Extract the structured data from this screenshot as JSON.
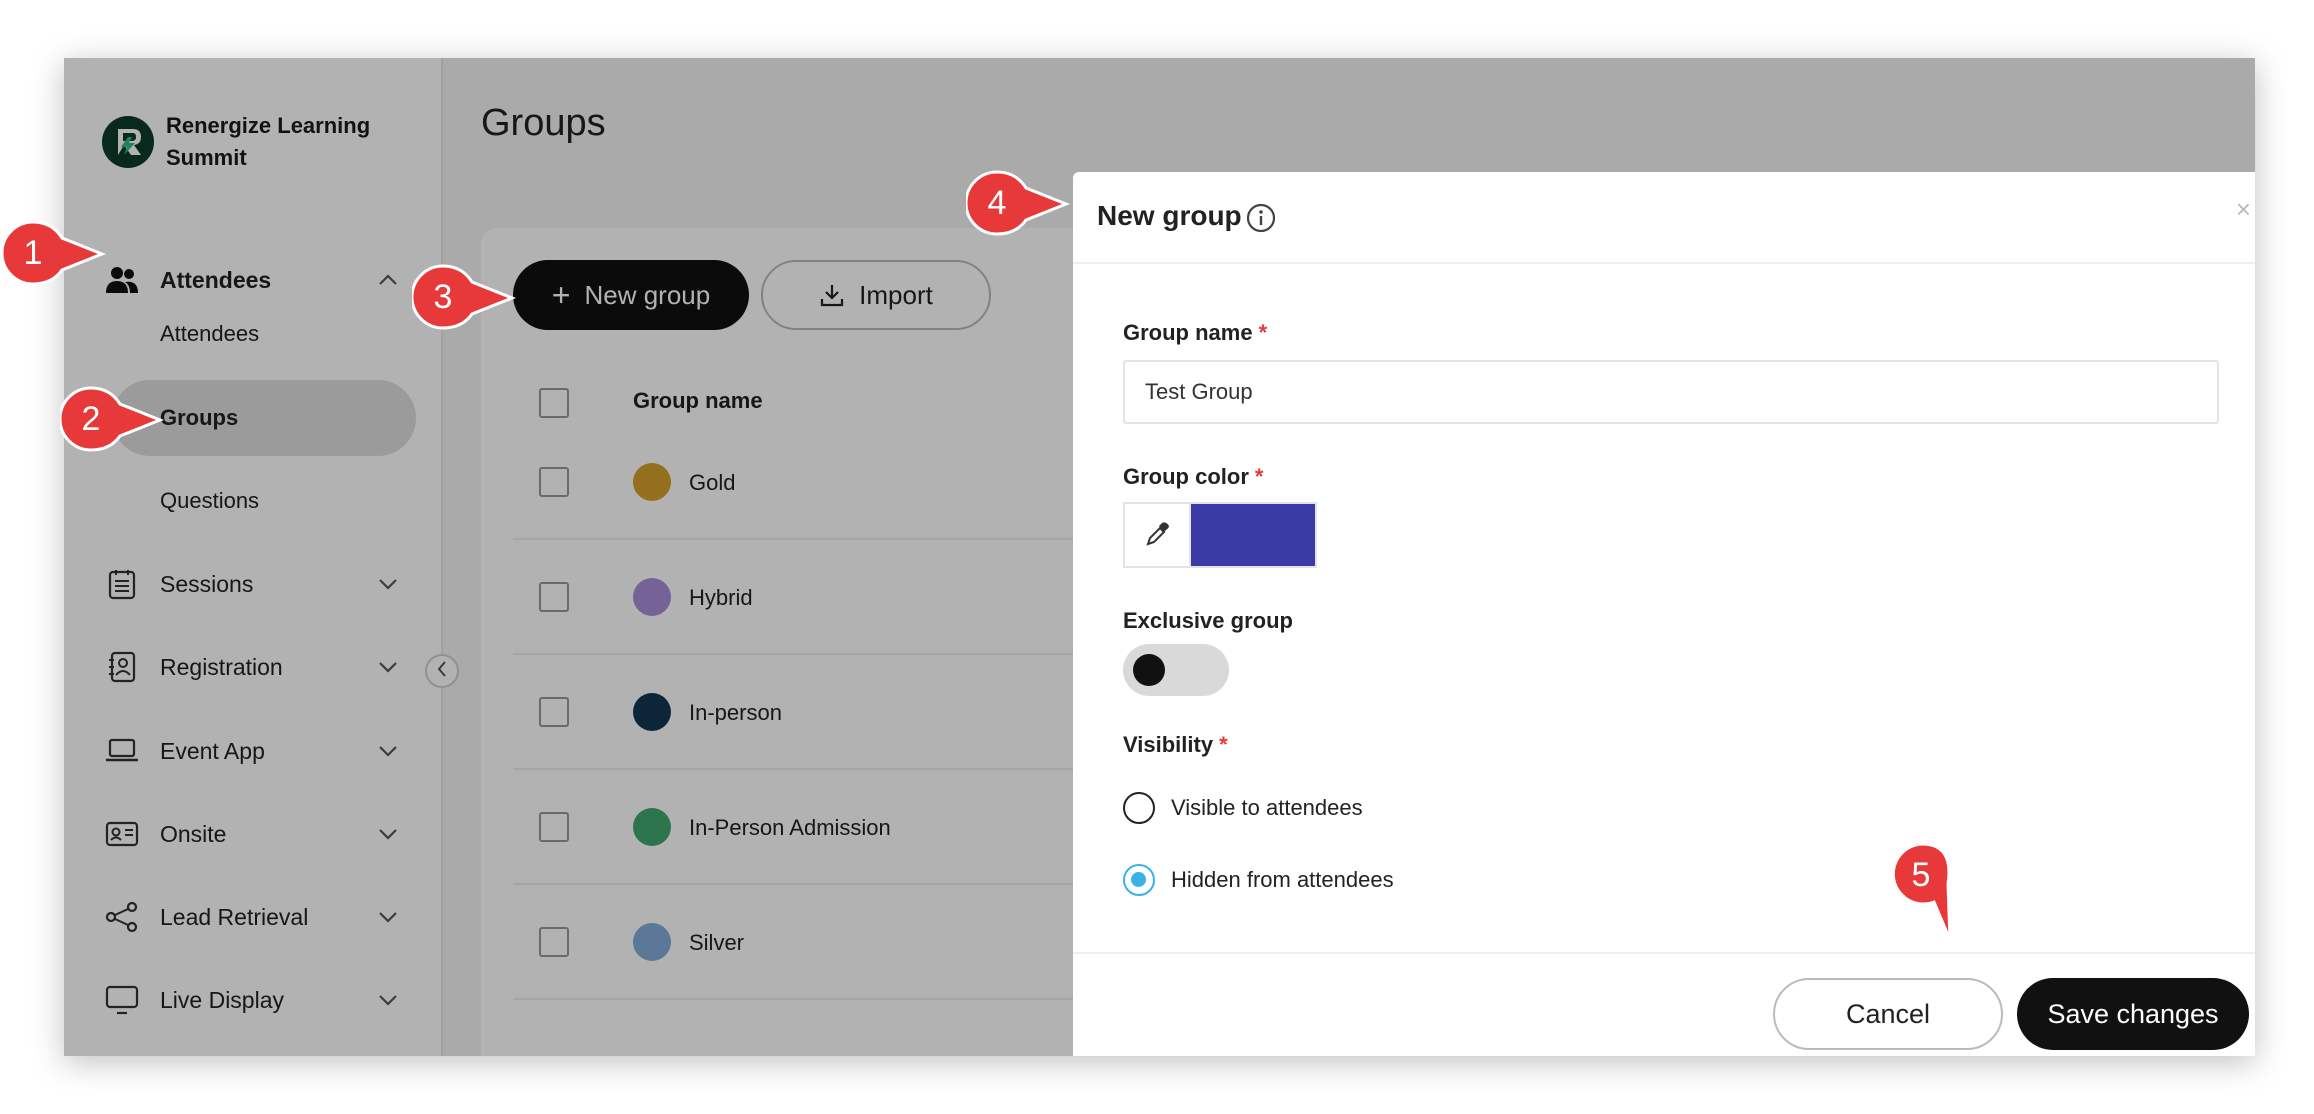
{
  "brand": {
    "name": "Renergize Learning Summit"
  },
  "sidebar": {
    "attendees_section": {
      "label": "Attendees",
      "sub_items": [
        {
          "label": "Attendees"
        },
        {
          "label": "Groups"
        },
        {
          "label": "Questions"
        }
      ]
    },
    "items": [
      {
        "label": "Sessions",
        "icon": "sessions-icon"
      },
      {
        "label": "Registration",
        "icon": "registration-icon"
      },
      {
        "label": "Event App",
        "icon": "laptop-icon"
      },
      {
        "label": "Onsite",
        "icon": "badge-icon"
      },
      {
        "label": "Lead Retrieval",
        "icon": "share-icon"
      },
      {
        "label": "Live Display",
        "icon": "monitor-icon"
      }
    ]
  },
  "main": {
    "title": "Groups",
    "new_group_label": "New group",
    "import_label": "Import",
    "column_group_name": "Group name",
    "groups": [
      {
        "name": "Gold",
        "color": "#d4a02c"
      },
      {
        "name": "Hybrid",
        "color": "#a88fd8"
      },
      {
        "name": "In-person",
        "color": "#143552"
      },
      {
        "name": "In-Person Admission",
        "color": "#3fa66e"
      },
      {
        "name": "Silver",
        "color": "#84addb"
      }
    ]
  },
  "modal": {
    "title": "New group",
    "close": "×",
    "group_name_label": "Group name",
    "group_name_value": "Test Group",
    "group_color_label": "Group color",
    "group_color_value": "#3b3ba6",
    "exclusive_label": "Exclusive group",
    "visibility_label": "Visibility",
    "visibility_options": [
      {
        "label": "Visible to attendees",
        "selected": false
      },
      {
        "label": "Hidden from attendees",
        "selected": true
      }
    ],
    "required_mark": "*",
    "cancel_label": "Cancel",
    "save_label": "Save changes"
  },
  "callouts": [
    "1",
    "2",
    "3",
    "4",
    "5"
  ],
  "colors": {
    "callout": "#e8393a",
    "accent": "#3ab2e8"
  }
}
